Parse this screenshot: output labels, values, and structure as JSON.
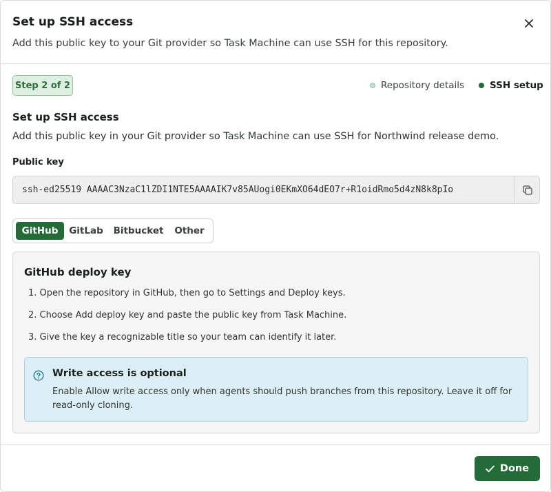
{
  "dialog": {
    "title": "Set up SSH access",
    "subtitle": "Add this public key to your Git provider so Task Machine can use SSH for this repository.",
    "close_icon": "close-icon"
  },
  "stepper": {
    "badge": "Step 2 of 2",
    "steps": [
      {
        "label": "Repository details",
        "state": "done"
      },
      {
        "label": "SSH setup",
        "state": "current"
      }
    ]
  },
  "section": {
    "title": "Set up SSH access",
    "description": "Add this public key in your Git provider so Task Machine can use SSH for Northwind release demo."
  },
  "public_key": {
    "label": "Public key",
    "value": "ssh-ed25519 AAAAC3NzaC1lZDI1NTE5AAAAIK7v85AUogi0EKmXO64dEO7r+R1oidRmo5d4zN8k8pIo",
    "copy_icon": "copy-icon"
  },
  "providers": {
    "tabs": [
      "GitHub",
      "GitLab",
      "Bitbucket",
      "Other"
    ],
    "selected": "GitHub"
  },
  "instructions": {
    "title": "GitHub deploy key",
    "steps": [
      "1. Open the repository in GitHub, then go to Settings and Deploy keys.",
      "2. Choose Add deploy key and paste the public key from Task Machine.",
      "3. Give the key a recognizable title so your team can identify it later."
    ],
    "note": {
      "icon": "question-circle-icon",
      "title": "Write access is optional",
      "body": "Enable Allow write access only when agents should push branches from this repository. Leave it off for read-only cloning."
    }
  },
  "footer": {
    "done_label": "Done",
    "done_icon": "check-icon"
  },
  "colors": {
    "primary": "#236b37",
    "badge_bg": "#dcefe0",
    "note_bg": "#ddeff6",
    "key_bg": "#eeefee"
  }
}
